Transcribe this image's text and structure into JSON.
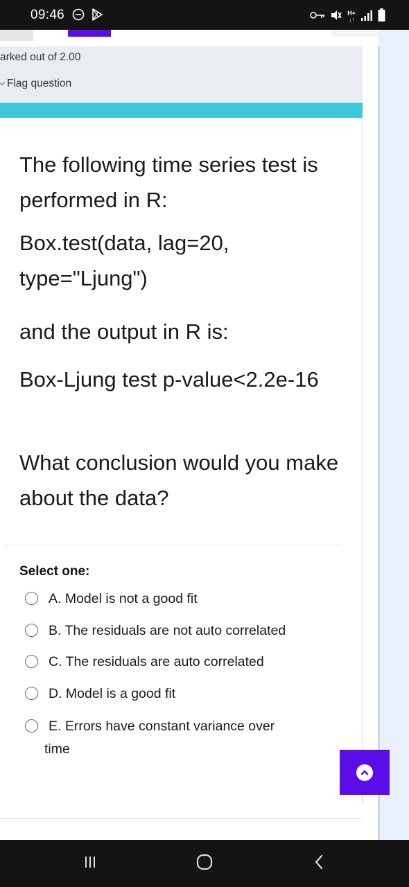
{
  "status_bar": {
    "time": "09:46",
    "icons": [
      "minus-circle-icon",
      "play-store-icon",
      "vpn-key-icon",
      "mute-icon",
      "network-h-plus-icon",
      "signal-icon",
      "battery-icon"
    ],
    "network_label": "H+"
  },
  "quiz_info": {
    "marked_out_of": "arked out of 2.00",
    "flag_question": "Flag question"
  },
  "question": {
    "line1": "The following time series test is performed in R:",
    "line2": "Box.test(data, lag=20, type=\"Ljung\")",
    "line3": "and the output in R is:",
    "line4": "Box-Ljung test p-value<2.2e-16",
    "line5": "What conclusion would you make about the data?"
  },
  "answers": {
    "prompt": "Select one:",
    "options": [
      {
        "label": "A. Model is not a good fit"
      },
      {
        "label": "B. The residuals are not auto correlated"
      },
      {
        "label": "C. The residuals are auto correlated"
      },
      {
        "label": "D. Model is a good fit"
      },
      {
        "label": "E. Errors have constant variance over",
        "continuation": "time"
      }
    ]
  },
  "scroll_button": {
    "icon": "chevron-up-icon"
  },
  "nav_bar": {
    "icons": [
      "recent-apps-icon",
      "home-icon",
      "back-icon"
    ]
  },
  "colors": {
    "accent": "#5b0de8",
    "question_header": "#3ec7d9",
    "info_box": "#e9edf1",
    "status_bar": "#141414"
  }
}
